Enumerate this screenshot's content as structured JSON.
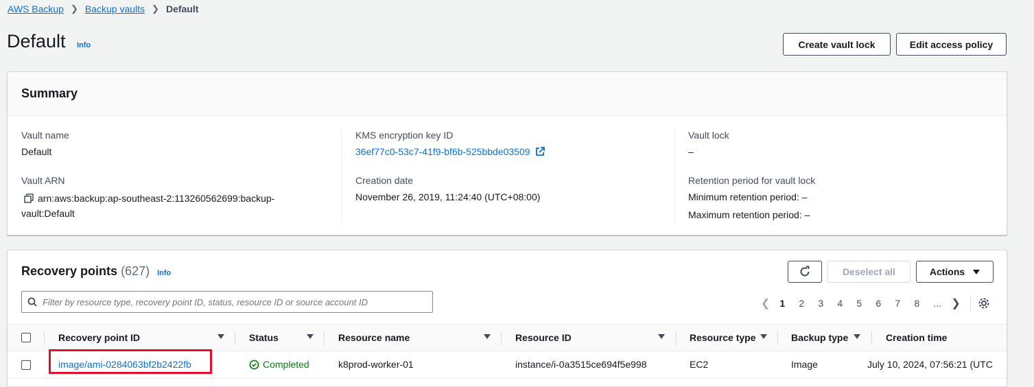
{
  "breadcrumb": [
    "AWS Backup",
    "Backup vaults",
    "Default"
  ],
  "page": {
    "title": "Default",
    "info": "Info",
    "buttons": {
      "create_vault_lock": "Create vault lock",
      "edit_access_policy": "Edit access policy"
    }
  },
  "summary": {
    "title": "Summary",
    "vault_name": {
      "label": "Vault name",
      "value": "Default"
    },
    "vault_arn": {
      "label": "Vault ARN",
      "value_line1": "arn:aws:backup:ap-southeast-2:113260562699:backup-",
      "value_line2": "vault:Default"
    },
    "kms_key": {
      "label": "KMS encryption key ID",
      "value": "36ef77c0-53c7-41f9-bf6b-525bbde03509"
    },
    "creation_date": {
      "label": "Creation date",
      "value": "November 26, 2019, 11:24:40 (UTC+08:00)"
    },
    "vault_lock": {
      "label": "Vault lock",
      "value": "–"
    },
    "retention": {
      "label": "Retention period for vault lock",
      "min": "Minimum retention period: –",
      "max": "Maximum retention period: –"
    }
  },
  "recovery_points": {
    "title": "Recovery points",
    "count": "(627)",
    "info": "Info",
    "deselect_all": "Deselect all",
    "actions": "Actions",
    "search_placeholder": "Filter by resource type, recovery point ID, status, resource ID or source account ID",
    "pages": [
      "1",
      "2",
      "3",
      "4",
      "5",
      "6",
      "7",
      "8",
      "..."
    ],
    "current_page": "1",
    "columns": [
      "Recovery point ID",
      "Status",
      "Resource name",
      "Resource ID",
      "Resource type",
      "Backup type",
      "Creation time"
    ],
    "rows": [
      {
        "id": "image/ami-0284063bf2b2422fb",
        "status": "Completed",
        "resource_name": "k8prod-worker-01",
        "resource_id": "instance/i-0a3515ce694f5e998",
        "resource_type": "EC2",
        "backup_type": "Image",
        "creation_time": "July 10, 2024, 07:56:21 (UTC"
      }
    ]
  },
  "colors": {
    "link": "#0972d3",
    "success": "#037f0c",
    "highlight": "#e0112b"
  }
}
